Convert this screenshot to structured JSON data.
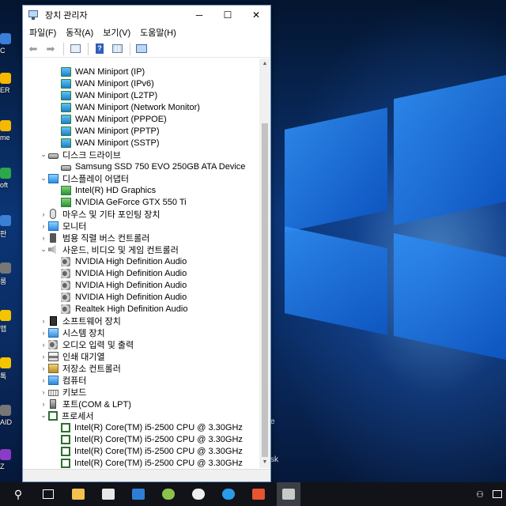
{
  "window": {
    "title": "장치 관리자",
    "controls": {
      "minimize": "─",
      "maximize": "☐",
      "close": "✕"
    }
  },
  "menu": [
    "파일(F)",
    "동작(A)",
    "보기(V)",
    "도움말(H)"
  ],
  "tree": [
    {
      "indent": 2,
      "expander": "",
      "icon": "network-adapter-icon",
      "label": "WAN Miniport (IP)"
    },
    {
      "indent": 2,
      "expander": "",
      "icon": "network-adapter-icon",
      "label": "WAN Miniport (IPv6)"
    },
    {
      "indent": 2,
      "expander": "",
      "icon": "network-adapter-icon",
      "label": "WAN Miniport (L2TP)"
    },
    {
      "indent": 2,
      "expander": "",
      "icon": "network-adapter-icon",
      "label": "WAN Miniport (Network Monitor)"
    },
    {
      "indent": 2,
      "expander": "",
      "icon": "network-adapter-icon",
      "label": "WAN Miniport (PPPOE)"
    },
    {
      "indent": 2,
      "expander": "",
      "icon": "network-adapter-icon",
      "label": "WAN Miniport (PPTP)"
    },
    {
      "indent": 2,
      "expander": "",
      "icon": "network-adapter-icon",
      "label": "WAN Miniport (SSTP)"
    },
    {
      "indent": 1,
      "expander": "⌄",
      "icon": "disk-drive-icon",
      "label": "디스크 드라이브"
    },
    {
      "indent": 2,
      "expander": "",
      "icon": "disk-drive-icon",
      "label": "Samsung SSD 750 EVO 250GB ATA Device"
    },
    {
      "indent": 1,
      "expander": "⌄",
      "icon": "display-adapter-icon",
      "label": "디스플레이 어댑터"
    },
    {
      "indent": 2,
      "expander": "",
      "icon": "gpu-icon",
      "label": "Intel(R) HD Graphics"
    },
    {
      "indent": 2,
      "expander": "",
      "icon": "gpu-icon",
      "label": "NVIDIA GeForce GTX 550 Ti"
    },
    {
      "indent": 1,
      "expander": "›",
      "icon": "mouse-icon",
      "label": "마우스 및 기타 포인팅 장치"
    },
    {
      "indent": 1,
      "expander": "›",
      "icon": "monitor-icon",
      "label": "모니터"
    },
    {
      "indent": 1,
      "expander": "›",
      "icon": "usb-icon",
      "label": "범용 직렬 버스 컨트롤러"
    },
    {
      "indent": 1,
      "expander": "⌄",
      "icon": "sound-icon",
      "label": "사운드, 비디오 및 게임 컨트롤러"
    },
    {
      "indent": 2,
      "expander": "",
      "icon": "audio-device-icon",
      "label": "NVIDIA High Definition Audio"
    },
    {
      "indent": 2,
      "expander": "",
      "icon": "audio-device-icon",
      "label": "NVIDIA High Definition Audio"
    },
    {
      "indent": 2,
      "expander": "",
      "icon": "audio-device-icon",
      "label": "NVIDIA High Definition Audio"
    },
    {
      "indent": 2,
      "expander": "",
      "icon": "audio-device-icon",
      "label": "NVIDIA High Definition Audio"
    },
    {
      "indent": 2,
      "expander": "",
      "icon": "audio-device-icon",
      "label": "Realtek High Definition Audio"
    },
    {
      "indent": 1,
      "expander": "›",
      "icon": "software-device-icon",
      "label": "소프트웨어 장치"
    },
    {
      "indent": 1,
      "expander": "›",
      "icon": "system-device-icon",
      "label": "시스템 장치"
    },
    {
      "indent": 1,
      "expander": "›",
      "icon": "audio-io-icon",
      "label": "오디오 입력 및 출력"
    },
    {
      "indent": 1,
      "expander": "›",
      "icon": "printer-icon",
      "label": "인쇄 대기열"
    },
    {
      "indent": 1,
      "expander": "›",
      "icon": "storage-controller-icon",
      "label": "저장소 컨트롤러"
    },
    {
      "indent": 1,
      "expander": "›",
      "icon": "computer-icon",
      "label": "컴퓨터"
    },
    {
      "indent": 1,
      "expander": "›",
      "icon": "keyboard-icon",
      "label": "키보드"
    },
    {
      "indent": 1,
      "expander": "›",
      "icon": "port-icon",
      "label": "포트(COM & LPT)"
    },
    {
      "indent": 1,
      "expander": "⌄",
      "icon": "processor-icon",
      "label": "프로세서"
    },
    {
      "indent": 2,
      "expander": "",
      "icon": "processor-icon",
      "label": "Intel(R) Core(TM) i5-2500 CPU @ 3.30GHz"
    },
    {
      "indent": 2,
      "expander": "",
      "icon": "processor-icon",
      "label": "Intel(R) Core(TM) i5-2500 CPU @ 3.30GHz"
    },
    {
      "indent": 2,
      "expander": "",
      "icon": "processor-icon",
      "label": "Intel(R) Core(TM) i5-2500 CPU @ 3.30GHz"
    },
    {
      "indent": 2,
      "expander": "",
      "icon": "processor-icon",
      "label": "Intel(R) Core(TM) i5-2500 CPU @ 3.30GHz"
    }
  ],
  "desktop_labels": [
    "C",
    "ER",
    "me",
    "oft",
    "판",
    "롱",
    "맵",
    "톡",
    "AID",
    "Z"
  ],
  "desktop_right_labels": [
    "e",
    "sk"
  ],
  "taskbar": {
    "tray_people": "⚇"
  },
  "colors": {
    "taskbar_bg": "#111318",
    "window_border": "#6c8fbf",
    "selection_accent": "#0078d7"
  }
}
